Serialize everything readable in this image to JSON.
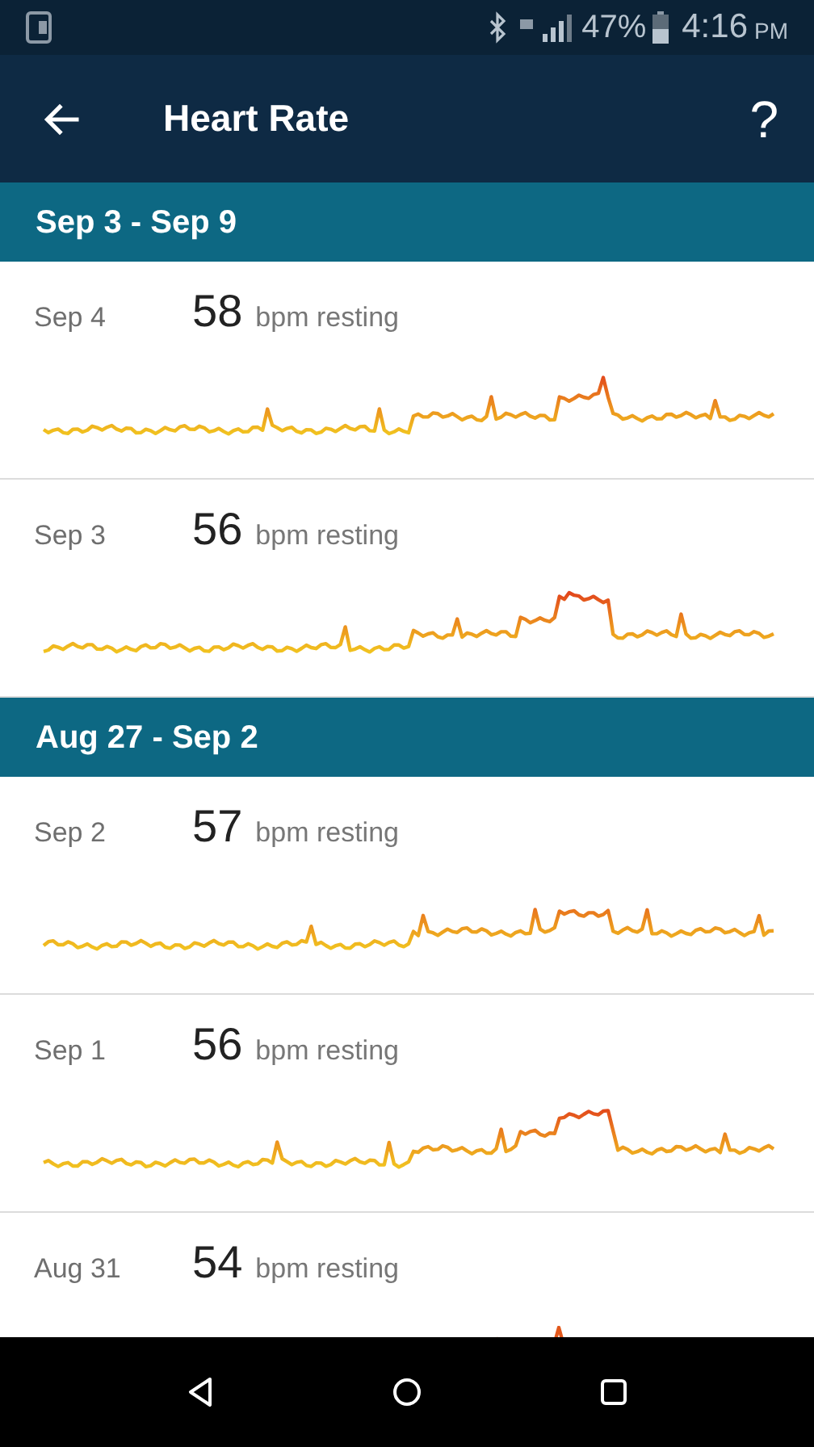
{
  "status_bar": {
    "battery": "47%",
    "time": "4:16",
    "meridiem": "PM"
  },
  "app_bar": {
    "title": "Heart Rate",
    "help": "?"
  },
  "weeks": [
    {
      "range": "Sep 3 - Sep 9",
      "days": [
        {
          "date": "Sep 4",
          "bpm": "58",
          "unit": "bpm resting"
        },
        {
          "date": "Sep 3",
          "bpm": "56",
          "unit": "bpm resting"
        }
      ]
    },
    {
      "range": "Aug 27 - Sep 2",
      "days": [
        {
          "date": "Sep 2",
          "bpm": "57",
          "unit": "bpm resting"
        },
        {
          "date": "Sep 1",
          "bpm": "56",
          "unit": "bpm resting"
        },
        {
          "date": "Aug 31",
          "bpm": "54",
          "unit": "bpm resting"
        }
      ]
    }
  ]
}
